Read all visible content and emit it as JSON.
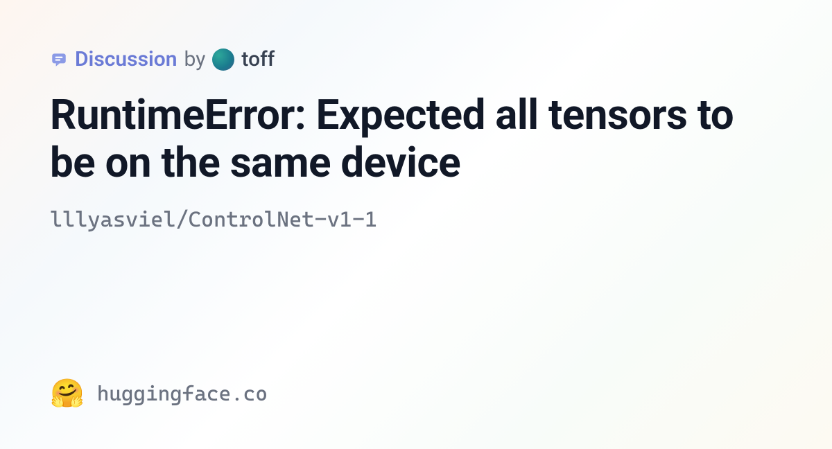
{
  "header": {
    "discussion_label": "Discussion",
    "by_text": "by",
    "username": "toff"
  },
  "title": "RuntimeError: Expected all tensors to be on the same device",
  "repo_path": "lllyasviel/ControlNet-v1-1",
  "footer": {
    "site": "huggingface.co"
  }
}
